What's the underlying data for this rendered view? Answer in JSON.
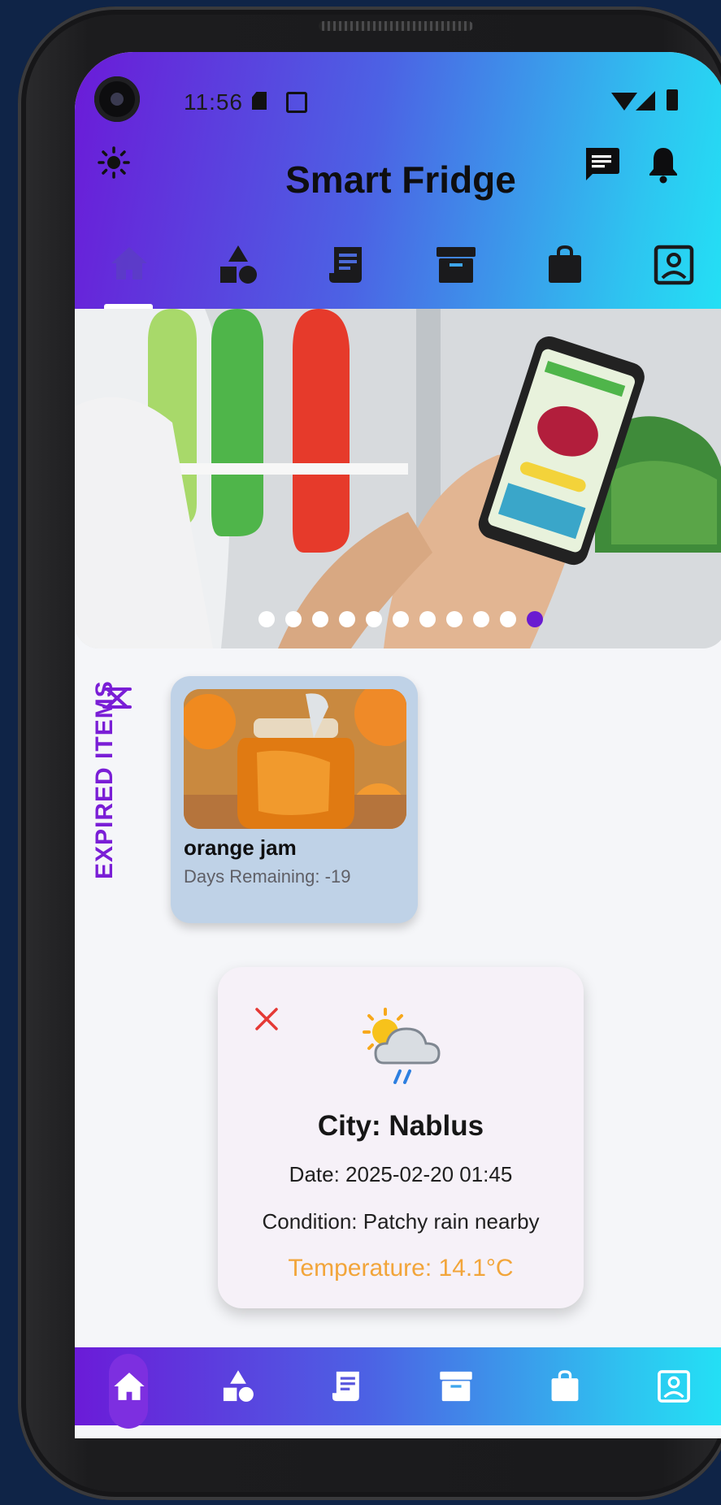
{
  "status_bar": {
    "time": "11:56"
  },
  "header": {
    "title": "Smart Fridge"
  },
  "top_tabs": [
    {
      "icon": "home-icon",
      "active": true
    },
    {
      "icon": "shapes-icon"
    },
    {
      "icon": "receipt-icon"
    },
    {
      "icon": "archive-icon"
    },
    {
      "icon": "shopping-bag-icon"
    },
    {
      "icon": "account-box-icon"
    }
  ],
  "carousel": {
    "total_slides": 11,
    "active_index": 10
  },
  "expired_section": {
    "label": "EXPIRED ITEMS",
    "items": [
      {
        "name": "orange jam",
        "days_remaining": "Days Remaining: -19"
      }
    ]
  },
  "weather": {
    "city": "City: Nablus",
    "date": "Date: 2025-02-20 01:45",
    "condition": "Condition: Patchy rain nearby",
    "temperature": "Temperature: 14.1°C"
  },
  "colors": {
    "accent": "#6a1bd0",
    "gradient_start": "#6b1bd8",
    "gradient_end": "#23e1f5",
    "temperature": "#f2a53a",
    "close": "#e53935"
  }
}
